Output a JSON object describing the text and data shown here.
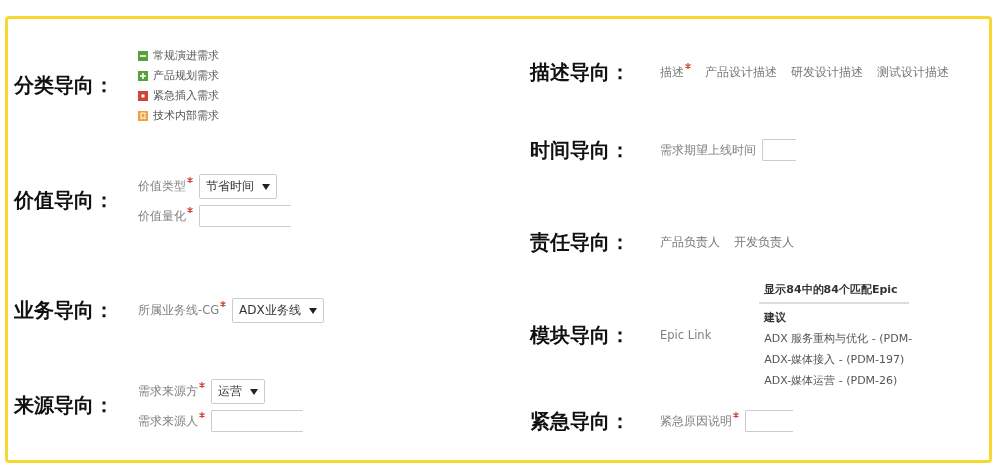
{
  "left_sections": [
    {
      "heading": "分类导向：",
      "kind": "categories",
      "items": [
        {
          "label": "常规演进需求",
          "kind": "minus",
          "color": "#5b9f3a"
        },
        {
          "label": "产品规划需求",
          "kind": "plus",
          "color": "#5b9f3a"
        },
        {
          "label": "紧急插入需求",
          "kind": "dot",
          "color": "#d04437"
        },
        {
          "label": "技术内部需求",
          "kind": "bookmark",
          "color": "#f0a03c"
        }
      ]
    },
    {
      "heading": "价值导向：",
      "kind": "fields",
      "fields": [
        {
          "label": "价值类型",
          "required": true,
          "kind": "select",
          "value": "节省时间"
        },
        {
          "label": "价值量化",
          "required": true,
          "kind": "input"
        }
      ]
    },
    {
      "heading": "业务导向：",
      "kind": "fields",
      "fields": [
        {
          "label": "所属业务线-CG",
          "required": true,
          "kind": "select",
          "value": "ADX业务线"
        }
      ]
    },
    {
      "heading": "来源导向：",
      "kind": "fields",
      "fields": [
        {
          "label": "需求来源方",
          "required": true,
          "kind": "select",
          "value": "运营"
        },
        {
          "label": "需求来源人",
          "required": true,
          "kind": "input"
        }
      ]
    }
  ],
  "right_sections": [
    {
      "heading": "描述导向：",
      "kind": "labels",
      "items": [
        {
          "label": "描述",
          "required": true
        },
        {
          "label": "产品设计描述",
          "required": false
        },
        {
          "label": "研发设计描述",
          "required": false
        },
        {
          "label": "测试设计描述",
          "required": false
        }
      ]
    },
    {
      "heading": "时间导向：",
      "kind": "fields",
      "fields": [
        {
          "label": "需求期望上线时间",
          "required": false,
          "kind": "input"
        }
      ]
    },
    {
      "heading": "责任导向：",
      "kind": "labels",
      "items": [
        {
          "label": "产品负责人",
          "required": false
        },
        {
          "label": "开发负责人",
          "required": false
        }
      ]
    },
    {
      "heading": "模块导向：",
      "kind": "fields",
      "fields": [
        {
          "label": "Epic Link",
          "required": false,
          "kind": "suggest",
          "summary": "显示84中的84个匹配Epic",
          "group": "建议",
          "options": [
            "ADX 服务重构与优化 - (PDM-",
            "ADX-媒体接入 - (PDM-197)",
            "ADX-媒体运营 - (PDM-26)"
          ]
        }
      ]
    },
    {
      "heading": "紧急导向：",
      "kind": "fields",
      "fields": [
        {
          "label": "紧急原因说明",
          "required": true,
          "kind": "input"
        }
      ]
    }
  ]
}
